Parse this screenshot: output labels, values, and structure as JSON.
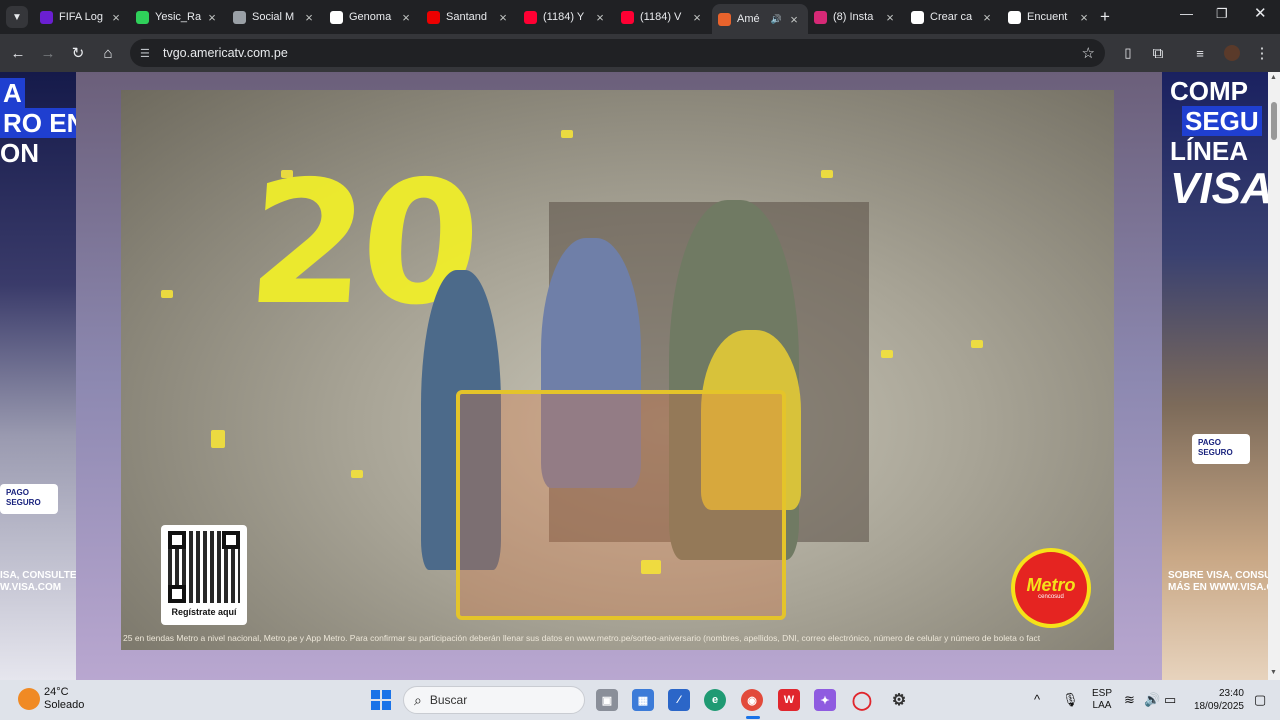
{
  "browser": {
    "tabs": [
      {
        "title": "FIFA Log",
        "icon": "fifa-icon",
        "color": "#6a1fd1"
      },
      {
        "title": "Yesic_Ra",
        "icon": "k-icon",
        "color": "#2fd05a"
      },
      {
        "title": "Social M",
        "icon": "globe-icon",
        "color": "#9aa0a6"
      },
      {
        "title": "Genoma",
        "icon": "genoma-icon",
        "color": "#ffffff"
      },
      {
        "title": "Santand",
        "icon": "santander-icon",
        "color": "#ec0000"
      },
      {
        "title": "(1184) Y",
        "icon": "youtube-icon",
        "color": "#ff0033"
      },
      {
        "title": "(1184) V",
        "icon": "youtube-icon",
        "color": "#ff0033"
      },
      {
        "title": "Amé",
        "icon": "america-icon",
        "color": "#e8632c",
        "active": true,
        "audio": true
      },
      {
        "title": "(8) Insta",
        "icon": "instagram-icon",
        "color": "#d62976"
      },
      {
        "title": "Crear ca",
        "icon": "openai-icon",
        "color": "#ffffff"
      },
      {
        "title": "Encuent",
        "icon": "tiktok-icon",
        "color": "#ffffff"
      }
    ],
    "new_tab": "+",
    "url": "tvgo.americatv.com.pe"
  },
  "page": {
    "left_ad": {
      "lines": [
        "A",
        "RO EN",
        "ON"
      ],
      "footer": [
        "ISA, CONSULTE",
        "W.VISA.COM"
      ],
      "badge": [
        "PAGO",
        "SEGURO"
      ]
    },
    "right_ad": {
      "lines": [
        "COMP",
        "SEGU",
        "LÍNEA",
        "VISA"
      ],
      "footer": [
        "SOBRE VISA, CONSU",
        "MÁS EN WWW.VISA.C"
      ],
      "badge": [
        "PAGO",
        "SEGURO"
      ]
    },
    "video": {
      "big_number": "20",
      "qr_label": "Regístrate aquí",
      "brand": "Metro",
      "brand_sub": "cencosud",
      "legal_text": "25 en tiendas Metro a nivel nacional, Metro.pe y App Metro. Para confirmar su participación deberán llenar sus datos en www.metro.pe/sorteo-aniversario (nombres, apellidos, DNI, correo electrónico, número de celular y número de boleta o fact"
    }
  },
  "taskbar": {
    "weather": {
      "temp": "24°C",
      "desc": "Soleado"
    },
    "search_placeholder": "Buscar",
    "lang": [
      "ESP",
      "LAA"
    ],
    "time": "23:40",
    "date": "18/09/2025"
  }
}
